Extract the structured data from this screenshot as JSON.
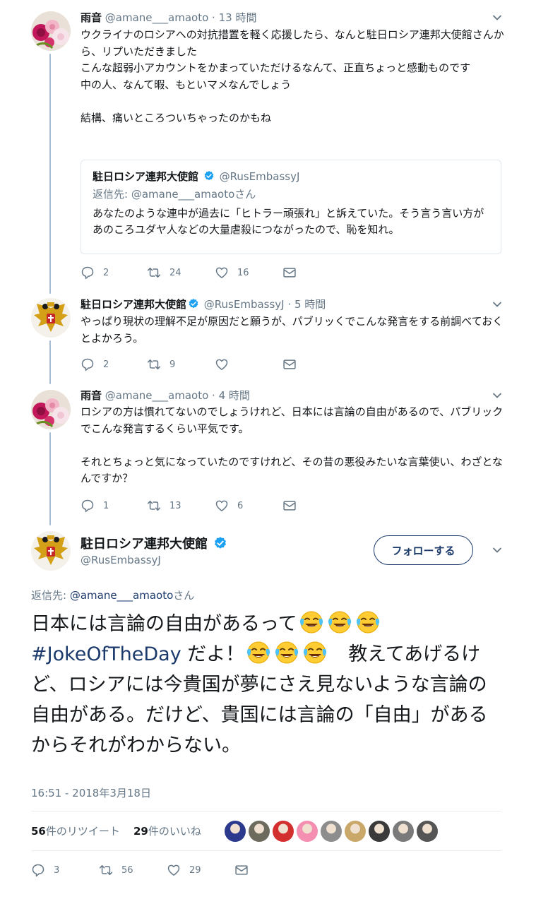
{
  "colors": {
    "link": "#1b3a6b",
    "verified": "#1da1f2",
    "thread_line": "#a9bdd2",
    "muted": "#657786"
  },
  "tweet1": {
    "name": "雨音",
    "handle": "@amane___amaoto",
    "time": "13 時間",
    "text": "ウクライナのロシアへの対抗措置を軽く応援したら、なんと駐日ロシア連邦大使館さんから、リプいただきました\nこんな超弱小アカウントをかまっていただけるなんて、正直ちょっと感動ものです\n中の人、なんて暇、もといマメなんでしょう\n\n結構、痛いところついちゃったのかもね",
    "quote": {
      "name": "駐日ロシア連邦大使館",
      "handle": "@RusEmbassyJ",
      "reply_label": "返信先: @amane___amaotoさん",
      "text": "あなたのような連中が過去に「ヒトラー頑張れ」と訴えていた。そう言う言い方があのころユダヤ人などの大量虐殺につながったので、恥を知れ。"
    },
    "actions": {
      "reply": "2",
      "retweet": "24",
      "like": "16"
    }
  },
  "tweet2": {
    "name": "駐日ロシア連邦大使館",
    "handle": "@RusEmbassyJ",
    "time": "5 時間",
    "text": "やっぱり現状の理解不足が原因だと願うが、パブリッくでこんな発言をする前調べておくとよかろう。",
    "actions": {
      "reply": "2",
      "retweet": "9",
      "like": ""
    }
  },
  "tweet3": {
    "name": "雨音",
    "handle": "@amane___amaoto",
    "time": "4 時間",
    "text": "ロシアの方は慣れてないのでしょうけれど、日本には言論の自由があるので、パブリックでこんな発言するくらい平気です。\n\nそれとちょっと気になっていたのですけれど、その昔の悪役みたいな言葉使い、わざとなんですか？",
    "actions": {
      "reply": "1",
      "retweet": "13",
      "like": "6"
    }
  },
  "main": {
    "name": "駐日ロシア連邦大使館",
    "handle": "@RusEmbassyJ",
    "follow_label": "フォローする",
    "reply_prefix": "返信先: ",
    "reply_handle": "@amane___amaoto",
    "reply_suffix": "さん",
    "text_1": "日本には言論の自由があるって",
    "hashtag": "#JokeOfTheDay",
    "text_2": " だよ！",
    "text_3": "　教えてあげるけど、ロシアには今貴国が夢にさえ見ないような言論の自由がある。だけど、貴国には言論の「自由」があるからそれがわからない。",
    "timestamp": "16:51 - 2018年3月18日",
    "retweets_count": "56",
    "retweets_label": "件のリツイート",
    "likes_count": "29",
    "likes_label": "件のいいね",
    "actions": {
      "reply": "3",
      "retweet": "56",
      "like": "29"
    },
    "liker_count": 9
  }
}
